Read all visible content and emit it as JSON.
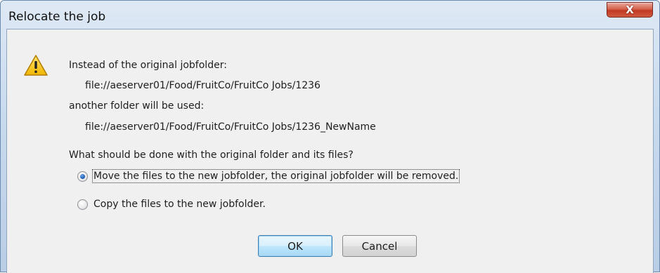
{
  "window": {
    "title": "Relocate the job"
  },
  "titlebar": {
    "close_icon_glyph": "X"
  },
  "message": {
    "icon": "warning-icon",
    "line1": "Instead of the original jobfolder:",
    "original_path": "file://aeserver01/Food/FruitCo/FruitCo Jobs/1236",
    "line2": "another folder will be used:",
    "new_path": "file://aeserver01/Food/FruitCo/FruitCo Jobs/1236_NewName",
    "question": "What should be done with the original folder and its files?"
  },
  "options": [
    {
      "label": "Move the files to the new jobfolder, the original jobfolder will be removed.",
      "checked": true
    },
    {
      "label": "Copy the files to the new jobfolder.",
      "checked": false
    }
  ],
  "buttons": {
    "ok_label": "OK",
    "cancel_label": "Cancel"
  },
  "colors": {
    "close_button": "#c23a22",
    "default_button_border": "#3c7fb1",
    "radio_selected": "#1f5fb8",
    "warning_fill": "#f5c400"
  }
}
